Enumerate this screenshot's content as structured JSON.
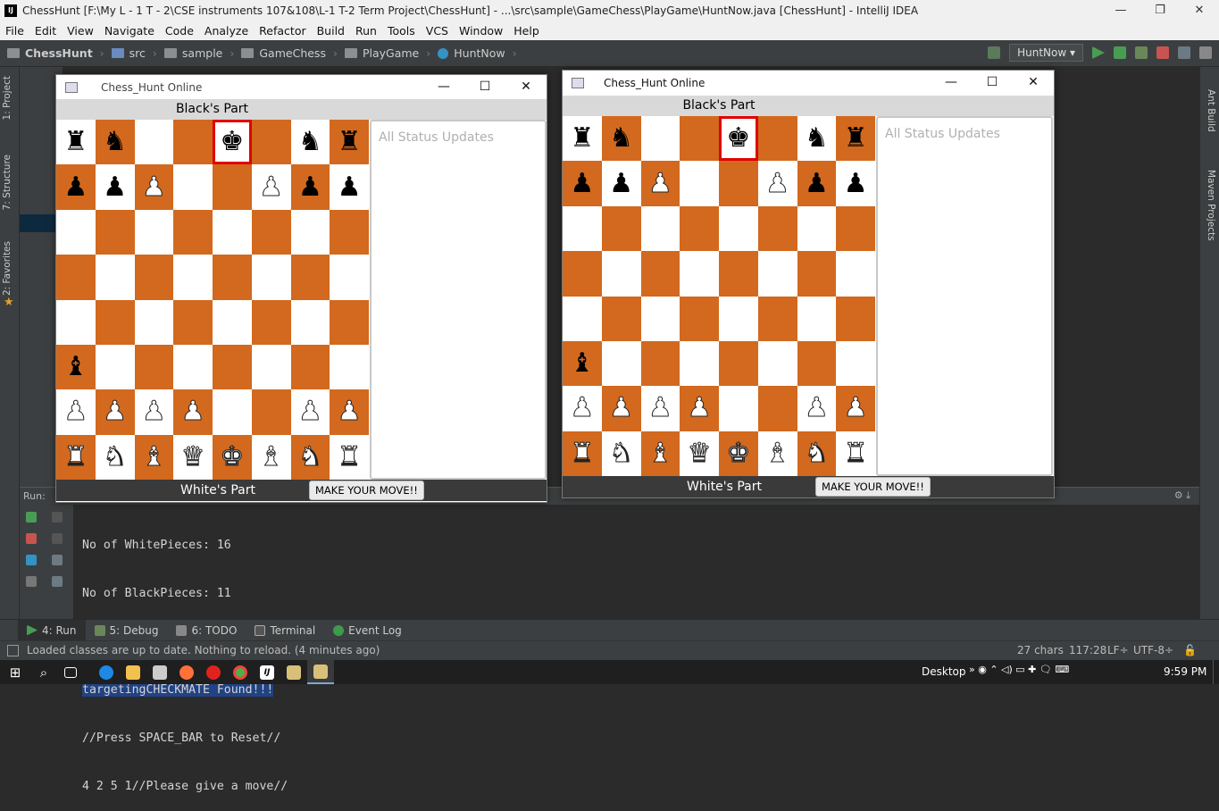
{
  "ide": {
    "title": "ChessHunt [F:\\My L - 1 T - 2\\CSE instruments 107&108\\L-1 T-2 Term Project\\ChessHunt] - ...\\src\\sample\\GameChess\\PlayGame\\HuntNow.java [ChessHunt] - IntelliJ IDEA",
    "menu": [
      "File",
      "Edit",
      "View",
      "Navigate",
      "Code",
      "Analyze",
      "Refactor",
      "Build",
      "Run",
      "Tools",
      "VCS",
      "Window",
      "Help"
    ],
    "breadcrumbs": [
      "ChessHunt",
      "src",
      "sample",
      "GameChess",
      "PlayGame",
      "HuntNow"
    ],
    "run_config": "HuntNow",
    "left_tabs": [
      "1: Project",
      "7: Structure",
      "2: Favorites"
    ],
    "right_tabs": [
      "Ant Build",
      "Maven Projects"
    ],
    "run_label": "Run:",
    "console_lines": [
      "No of WhitePieces: 16",
      "No of BlackPieces: 11",
      "/*********************/",
      "targetingCHECKMATE Found!!!",
      "//Press SPACE_BAR to Reset//",
      "4 2 5 1//Please give a move//"
    ],
    "console_highlight_index": 3,
    "bottom_tabs": [
      {
        "label": "4: Run",
        "active": true,
        "color": "#499c54"
      },
      {
        "label": "5: Debug",
        "active": false,
        "color": "#6a8759"
      },
      {
        "label": "6: TODO",
        "active": false,
        "color": "#888"
      },
      {
        "label": "Terminal",
        "active": false,
        "color": "#777"
      },
      {
        "label": "Event Log",
        "active": false,
        "color": "#3d9c4c"
      }
    ],
    "status_message": "Loaded classes are up to date. Nothing to reload. (4 minutes ago)",
    "status_chars": "27 chars",
    "status_pos": "117:28",
    "status_lf": "LF÷",
    "status_enc": "UTF-8÷"
  },
  "taskbar": {
    "desktop_label": "Desktop",
    "time": "9:59 PM"
  },
  "chess_windows": [
    {
      "title": "Chess_Hunt Online",
      "top_label": "Black's Part",
      "bottom_label": "White's Part",
      "status_placeholder": "All Status Updates",
      "move_button": "MAKE YOUR MOVE!!",
      "selected_square": [
        0,
        4
      ],
      "board": [
        [
          "br",
          "bn",
          "",
          "",
          "bk",
          "",
          "bn",
          "br"
        ],
        [
          "bp",
          "bp",
          "wp",
          "",
          "",
          "wp",
          "bp",
          "bp"
        ],
        [
          "",
          "",
          "",
          "",
          "",
          "",
          "",
          ""
        ],
        [
          "",
          "",
          "",
          "",
          "",
          "",
          "",
          ""
        ],
        [
          "",
          "",
          "",
          "",
          "",
          "",
          "",
          ""
        ],
        [
          "bb",
          "",
          "",
          "",
          "",
          "",
          "",
          ""
        ],
        [
          "wp",
          "wp",
          "wp",
          "wp",
          "",
          "",
          "wp",
          "wp"
        ],
        [
          "wr",
          "wn",
          "wb",
          "wq",
          "wk",
          "wb",
          "wn",
          "wr"
        ]
      ]
    },
    {
      "title": "Chess_Hunt Online",
      "top_label": "Black's Part",
      "bottom_label": "White's Part",
      "status_placeholder": "All Status Updates",
      "move_button": "MAKE YOUR MOVE!!",
      "selected_square": [
        0,
        4
      ],
      "board": [
        [
          "br",
          "bn",
          "",
          "",
          "bk",
          "",
          "bn",
          "br"
        ],
        [
          "bp",
          "bp",
          "wp",
          "",
          "",
          "wp",
          "bp",
          "bp"
        ],
        [
          "",
          "",
          "",
          "",
          "",
          "",
          "",
          ""
        ],
        [
          "",
          "",
          "",
          "",
          "",
          "",
          "",
          ""
        ],
        [
          "",
          "",
          "",
          "",
          "",
          "",
          "",
          ""
        ],
        [
          "bb",
          "",
          "",
          "",
          "",
          "",
          "",
          ""
        ],
        [
          "wp",
          "wp",
          "wp",
          "wp",
          "",
          "",
          "wp",
          "wp"
        ],
        [
          "wr",
          "wn",
          "wb",
          "wq",
          "wk",
          "wb",
          "wn",
          "wr"
        ]
      ]
    }
  ]
}
